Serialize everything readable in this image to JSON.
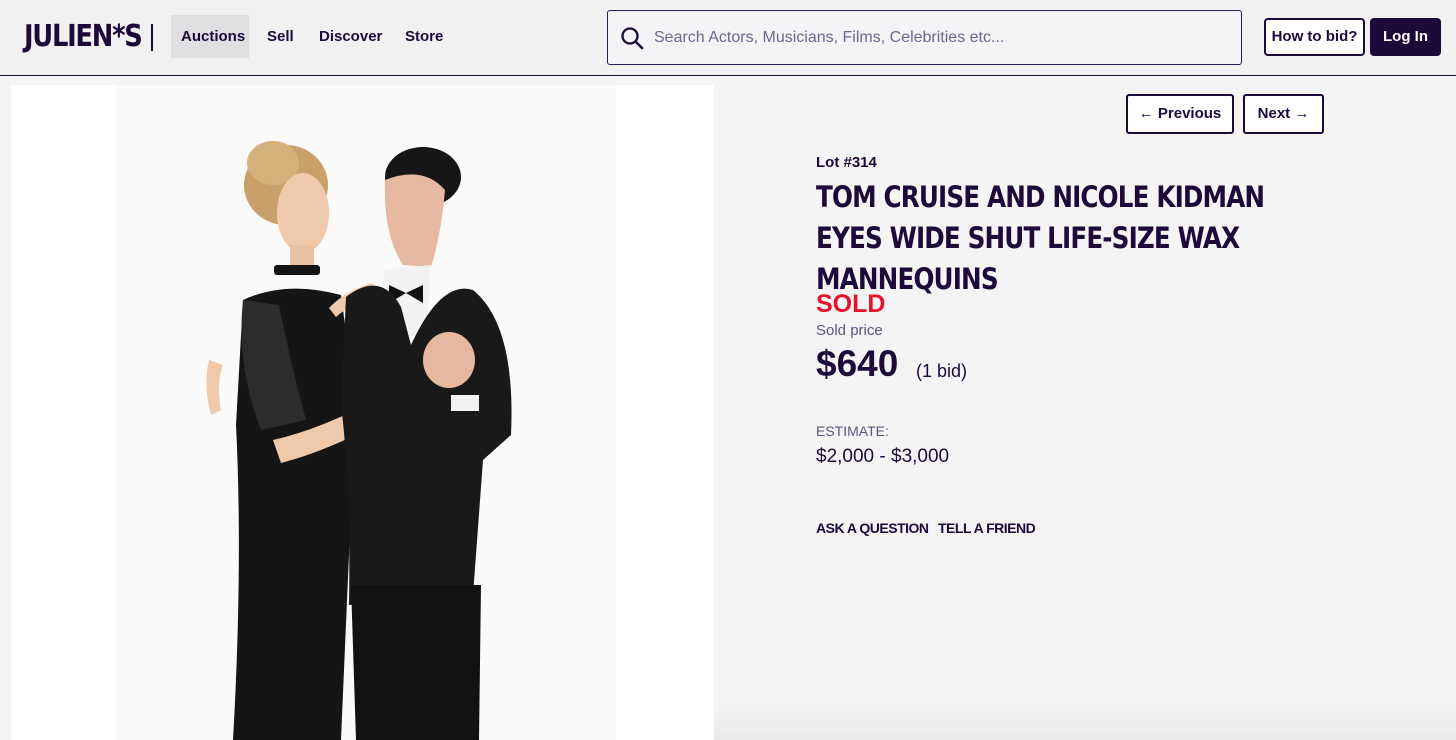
{
  "header": {
    "logo": "JULIEN*S",
    "nav": [
      {
        "label": "Auctions"
      },
      {
        "label": "Sell"
      },
      {
        "label": "Discover"
      },
      {
        "label": "Store"
      }
    ],
    "search": {
      "placeholder": "Search Actors, Musicians, Films, Celebrities etc..."
    },
    "how_to_bid": "How to bid?",
    "login": "Log In"
  },
  "pager": {
    "previous": "Previous",
    "next": "Next"
  },
  "lot": {
    "number": "Lot #314",
    "title": "TOM CRUISE AND NICOLE KIDMAN EYES WIDE SHUT LIFE-SIZE WAX MANNEQUINS",
    "status": "SOLD",
    "sold_price_label": "Sold price",
    "sold_price": "$640",
    "bids": "(1 bid)",
    "estimate_label": "ESTIMATE:",
    "estimate_value": "$2,000 - $3,000"
  },
  "actions": {
    "ask": "ASK A QUESTION",
    "tell": "TELL A FRIEND"
  },
  "colors": {
    "brand": "#1d0a3a",
    "sold": "#e8112d",
    "page_bg": "#f4f4f4"
  }
}
